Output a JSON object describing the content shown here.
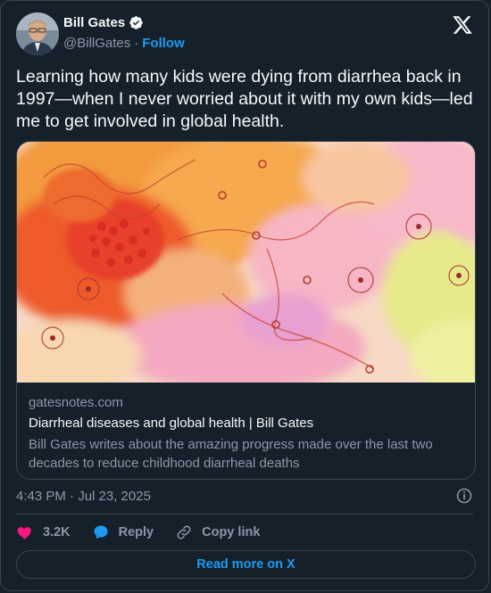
{
  "author": {
    "display_name": "Bill Gates",
    "handle": "@BillGates",
    "separator": "·",
    "follow_label": "Follow"
  },
  "tweet": {
    "text": "Learning how many kids were dying from diarrhea back in 1997—when I never worried about it with my own kids—led me to get involved in global health."
  },
  "link_card": {
    "domain": "gatesnotes.com",
    "title": "Diarrheal diseases and global health | Bill Gates",
    "description": "Bill Gates writes about the amazing progress made over the last two decades to reduce childhood diarrheal deaths"
  },
  "meta": {
    "timestamp": "4:43 PM · Jul 23, 2025"
  },
  "actions": {
    "like_count": "3.2K",
    "reply_label": "Reply",
    "copy_label": "Copy link"
  },
  "footer": {
    "read_more_label": "Read more on X"
  },
  "colors": {
    "background": "#15202b",
    "border": "#38444d",
    "accent": "#1d9bf0",
    "like": "#f91880",
    "secondary_text": "#8b98a5"
  },
  "icons": [
    "verified-badge-icon",
    "x-logo-icon",
    "info-icon",
    "heart-icon",
    "reply-bubble-icon",
    "link-icon"
  ]
}
